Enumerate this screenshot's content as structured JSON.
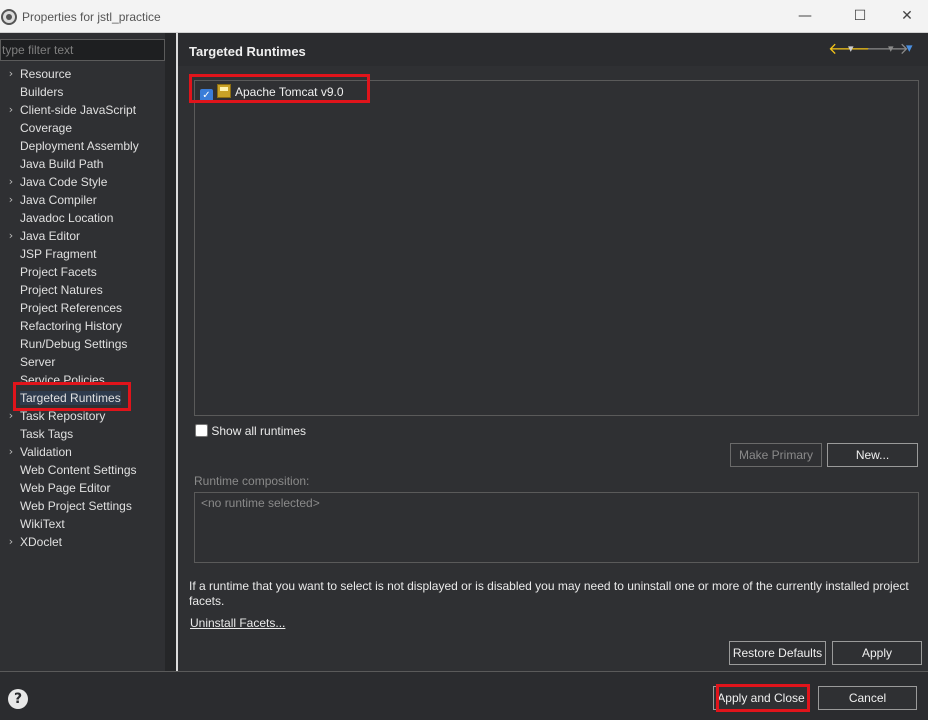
{
  "window": {
    "title": "Properties for jstl_practice",
    "minimize": "—",
    "maximize": "☐",
    "close": "✕"
  },
  "sidebar": {
    "filter_placeholder": "type filter text",
    "items": [
      {
        "label": "Resource",
        "expandable": true
      },
      {
        "label": "Builders",
        "expandable": false
      },
      {
        "label": "Client-side JavaScript",
        "expandable": true
      },
      {
        "label": "Coverage",
        "expandable": false
      },
      {
        "label": "Deployment Assembly",
        "expandable": false
      },
      {
        "label": "Java Build Path",
        "expandable": false
      },
      {
        "label": "Java Code Style",
        "expandable": true
      },
      {
        "label": "Java Compiler",
        "expandable": true
      },
      {
        "label": "Javadoc Location",
        "expandable": false
      },
      {
        "label": "Java Editor",
        "expandable": true
      },
      {
        "label": "JSP Fragment",
        "expandable": false
      },
      {
        "label": "Project Facets",
        "expandable": false
      },
      {
        "label": "Project Natures",
        "expandable": false
      },
      {
        "label": "Project References",
        "expandable": false
      },
      {
        "label": "Refactoring History",
        "expandable": false
      },
      {
        "label": "Run/Debug Settings",
        "expandable": false
      },
      {
        "label": "Server",
        "expandable": false
      },
      {
        "label": "Service Policies",
        "expandable": false
      },
      {
        "label": "Targeted Runtimes",
        "expandable": false,
        "selected": true
      },
      {
        "label": "Task Repository",
        "expandable": true
      },
      {
        "label": "Task Tags",
        "expandable": false
      },
      {
        "label": "Validation",
        "expandable": true
      },
      {
        "label": "Web Content Settings",
        "expandable": false
      },
      {
        "label": "Web Page Editor",
        "expandable": false
      },
      {
        "label": "Web Project Settings",
        "expandable": false
      },
      {
        "label": "WikiText",
        "expandable": false
      },
      {
        "label": "XDoclet",
        "expandable": true
      }
    ]
  },
  "main": {
    "title": "Targeted Runtimes",
    "nav": {
      "back": "🡐",
      "back_menu": "▾",
      "forward": "🡒",
      "forward_menu": "▾",
      "view_menu": "▾"
    },
    "runtimes": [
      {
        "label": "Apache Tomcat v9.0",
        "checked": true,
        "check_glyph": "✓"
      }
    ],
    "show_all_label": "Show all runtimes",
    "buttons": {
      "make_primary": "Make Primary",
      "new": "New...",
      "restore_defaults": "Restore Defaults",
      "apply": "Apply"
    },
    "composition_label": "Runtime composition:",
    "composition_empty": "<no runtime selected>",
    "info_text": "If a runtime that you want to select is not displayed or is disabled you may need to uninstall one or more of the currently installed project facets.",
    "uninstall_link": "Uninstall Facets..."
  },
  "footer": {
    "help": "?",
    "apply_and_close": "Apply and Close",
    "cancel": "Cancel"
  },
  "colors": {
    "background": "#2f3033",
    "highlight": "#e0141b",
    "accent": "#3b7dd8",
    "back_arrow": "#f5c518"
  }
}
